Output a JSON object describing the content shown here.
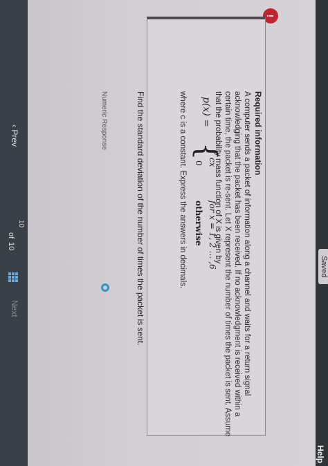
{
  "header": {
    "saved_label": "Saved",
    "help_label": "Help"
  },
  "alert": {
    "icon": "!"
  },
  "required": {
    "title": "Required information",
    "text": "A computer sends a packet of information along a channel and waits for a return signal acknowledging that the packet has been received. If no acknowledgment is received within a certain time, the packet is re-sent. Let X represent the number of times the packet is sent. Assume that the probability mass function of X is given by",
    "pmf_lhs": "p(x) =",
    "pmf_case1_value": "cx",
    "pmf_case1_cond": "for x = 1, 2 … ,6",
    "pmf_case2_value": "0",
    "pmf_case2_cond": "otherwise",
    "tail": "where c is a constant. Express the answers in decimals."
  },
  "question": {
    "prompt": "Find the standard deviation of the number of times the packet is sent.",
    "response_label": "Numeric Response"
  },
  "footer": {
    "prev_label": "Prev",
    "page_current": "10",
    "of_label": "of",
    "page_total": "10",
    "next_label": "Next"
  },
  "colors": {
    "alert": "#c0262e",
    "accent": "#2a97c9"
  }
}
